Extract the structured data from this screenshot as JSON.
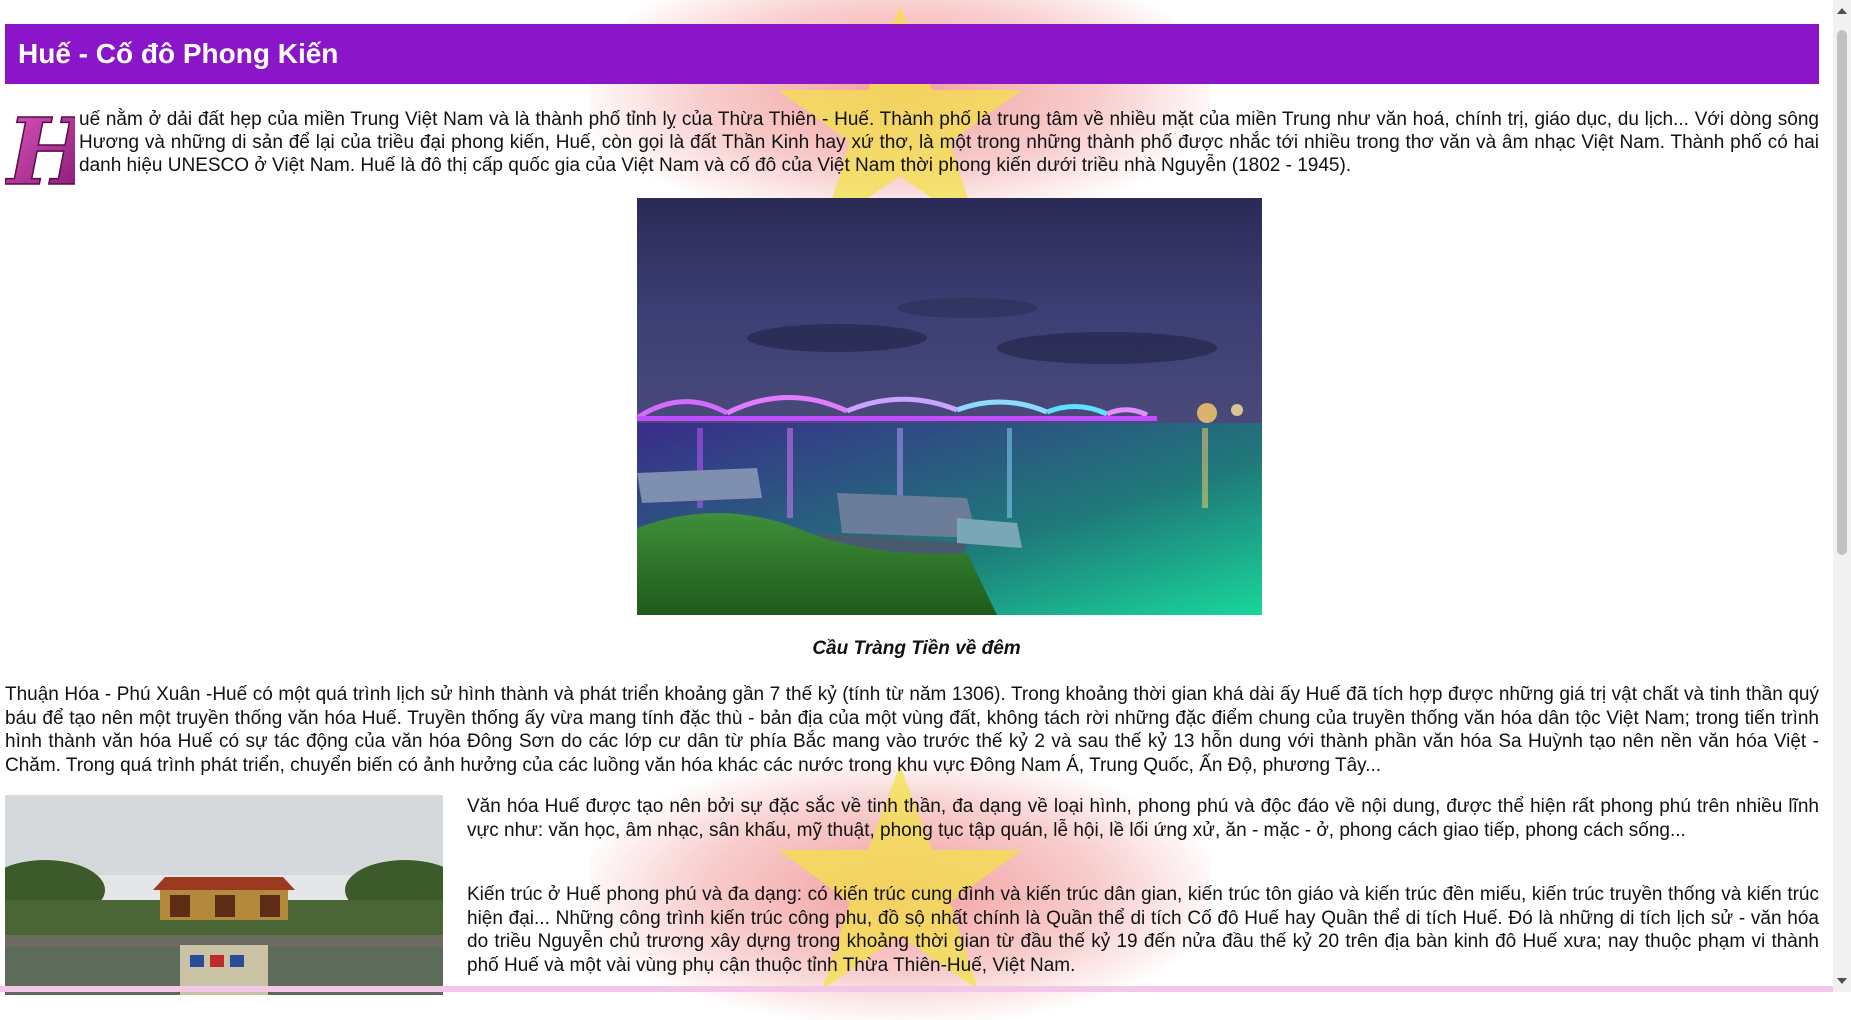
{
  "page": {
    "title": "Huế - Cố đô Phong Kiến",
    "intro_dropcap": "H",
    "intro_text": "uế nằm ở dải đất hẹp của miền Trung Việt Nam và là thành phố tỉnh lỵ của Thừa Thiên - Huế. Thành phố là trung tâm về nhiều mặt của miền Trung như văn hoá, chính trị, giáo dục, du lịch... Với dòng sông Hương và những di sản để lại của triều đại phong kiến, Huế, còn gọi là đất Thần Kinh hay xứ thơ, là một trong những thành phố được nhắc tới nhiều trong thơ văn và âm nhạc Việt Nam. Thành phố có hai danh hiệu UNESCO ở Việt Nam. Huế là đô thị cấp quốc gia của Việt Nam và cố đô của Việt Nam thời phong kiến dưới triều nhà Nguyễn (1802 - 1945).",
    "figure_caption": "Cầu Tràng Tiền về đêm",
    "paragraph_2": "Thuận Hóa - Phú Xuân -Huế có một quá trình lịch sử hình thành và phát triển khoảng gần 7 thế kỷ (tính từ năm 1306). Trong khoảng thời gian khá dài ấy Huế đã tích hợp được những giá trị vật chất và tinh thần quý báu để tạo nên một truyền thống văn hóa Huế. Truyền thống ấy vừa mang tính đặc thù - bản địa của một vùng đất, không tách rời những đặc điểm chung của truyền thống văn hóa dân tộc Việt Nam; trong tiến trình hình thành văn hóa Huế có sự tác động của văn hóa Đông Sơn do các lớp cư dân từ phía Bắc mang vào trước thế kỷ 2 và sau thế kỷ 13 hỗn dung với thành phần văn hóa Sa Huỳnh tạo nên nền văn hóa Việt - Chăm. Trong quá trình phát triển, chuyển biến có ảnh hưởng của các luồng văn hóa khác các nước trong khu vực Đông Nam Á, Trung Quốc, Ấn Độ, phương Tây...",
    "paragraph_3": "Văn hóa Huế được tạo nên bởi sự đặc sắc về tinh thần, đa dạng về loại hình, phong phú và độc đáo về nội dung, được thể hiện rất phong phú trên nhiều lĩnh vực như: văn học, âm nhạc, sân khấu, mỹ thuật, phong tục tập quán, lễ hội, lề lối ứng xử, ăn - mặc - ở, phong cách giao tiếp, phong cách sống...",
    "paragraph_4": "Kiến trúc ở Huế phong phú và đa dạng: có kiến trúc cung đình và kiến trúc dân gian, kiến trúc tôn giáo và kiến trúc đền miếu, kiến trúc truyền thống và kiến trúc hiện đại... Những công trình kiến trúc công phu, đồ sộ nhất chính là Quần thể di tích Cố đô Huế hay Quần thể di tích Huế. Đó là những di tích lịch sử - văn hóa do triều Nguyễn chủ trương xây dựng trong khoảng thời gian từ đầu thế kỷ 19 đến nửa đầu thế kỷ 20 trên địa bàn kinh đô Huế xưa; nay thuộc phạm vi thành phố Huế và một vài vùng phụ cận thuộc tỉnh Thừa Thiên-Huế, Việt Nam."
  },
  "colors": {
    "title_bar": "#8b16c9",
    "dropcap": "#b0178e",
    "background_glow": "#e65050",
    "star": "#f3e14a"
  },
  "icons": {
    "dropcap": "ornamental-letter",
    "figure": "bridge-night-photo",
    "side_image": "citadel-gate-photo"
  }
}
